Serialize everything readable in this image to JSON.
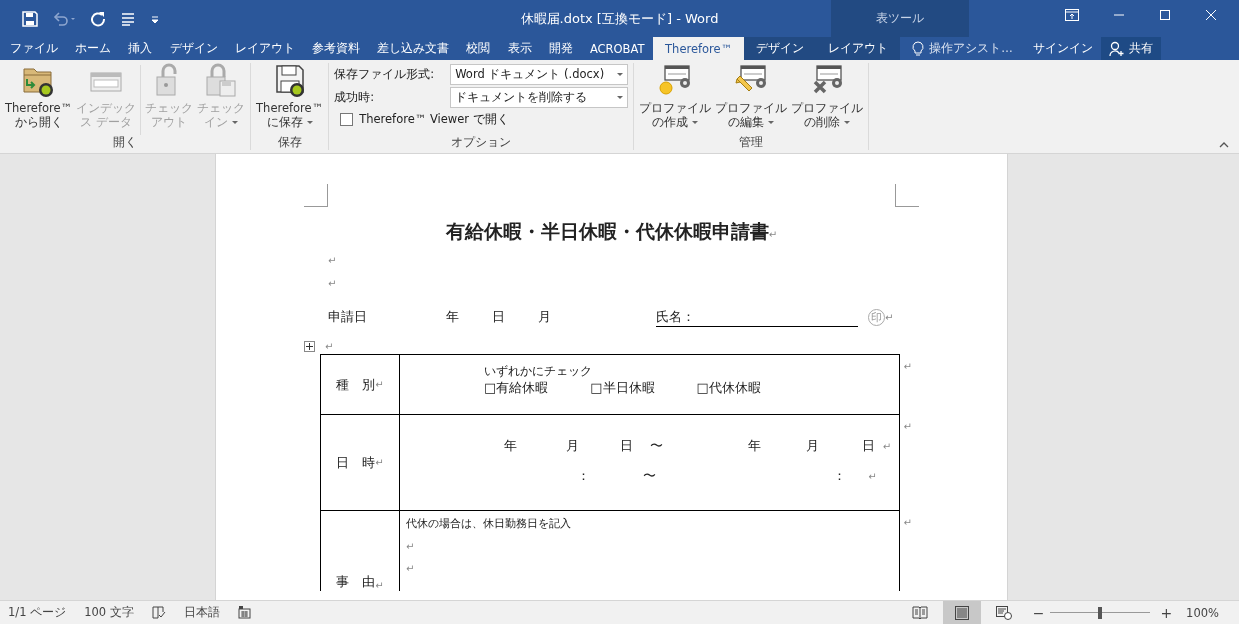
{
  "window": {
    "title": "休暇届.dotx [互換モード] - Word"
  },
  "contextual": {
    "label": "表ツール"
  },
  "tabs": [
    {
      "label": "ファイル",
      "selected": false,
      "contextual": false
    },
    {
      "label": "ホーム",
      "selected": false,
      "contextual": false
    },
    {
      "label": "挿入",
      "selected": false,
      "contextual": false
    },
    {
      "label": "デザイン",
      "selected": false,
      "contextual": false
    },
    {
      "label": "レイアウト",
      "selected": false,
      "contextual": false
    },
    {
      "label": "参考資料",
      "selected": false,
      "contextual": false
    },
    {
      "label": "差し込み文書",
      "selected": false,
      "contextual": false
    },
    {
      "label": "校閲",
      "selected": false,
      "contextual": false
    },
    {
      "label": "表示",
      "selected": false,
      "contextual": false
    },
    {
      "label": "開発",
      "selected": false,
      "contextual": false
    },
    {
      "label": "ACROBAT",
      "selected": false,
      "contextual": false
    },
    {
      "label": "Therefore™",
      "selected": true,
      "contextual": false
    },
    {
      "label": "デザイン",
      "selected": false,
      "contextual": true
    },
    {
      "label": "レイアウト",
      "selected": false,
      "contextual": true
    }
  ],
  "tell_me": {
    "placeholder": "操作アシスト…"
  },
  "sign_in": "サインイン",
  "share": "共有",
  "ribbon": {
    "groups": [
      {
        "label": "開く",
        "items": [
          {
            "kind": "open",
            "lines": [
              "Therefore™",
              "から開く"
            ],
            "disabled": false,
            "dropdown": false
          },
          {
            "kind": "index",
            "lines": [
              "インデック",
              "ス データ"
            ],
            "disabled": true,
            "dropdown": false
          },
          {
            "kind": "checkout",
            "lines": [
              "チェック",
              "アウト"
            ],
            "disabled": true,
            "dropdown": false
          },
          {
            "kind": "checkin",
            "lines": [
              "チェック",
              "イン"
            ],
            "disabled": true,
            "dropdown": true
          }
        ]
      },
      {
        "label": "保存",
        "items": [
          {
            "kind": "save",
            "lines": [
              "Therefore™",
              "に保存"
            ],
            "disabled": false,
            "dropdown": true
          }
        ]
      },
      {
        "label": "オプション",
        "options": {
          "fields": [
            {
              "label": "保存ファイル形式:",
              "value": "Word ドキュメント (.docx)"
            },
            {
              "label": "成功時:",
              "value": "ドキュメントを削除する"
            }
          ],
          "checkbox": {
            "label": "Therefore™ Viewer で開く",
            "checked": false
          }
        }
      },
      {
        "label": "管理",
        "items": [
          {
            "kind": "create",
            "lines": [
              "プロファイル",
              "の作成"
            ],
            "disabled": false,
            "dropdown": true
          },
          {
            "kind": "edit",
            "lines": [
              "プロファイル",
              "の編集"
            ],
            "disabled": false,
            "dropdown": true
          },
          {
            "kind": "delete",
            "lines": [
              "プロファイル",
              "の削除"
            ],
            "disabled": false,
            "dropdown": true
          }
        ]
      }
    ]
  },
  "document": {
    "title": {
      "text": "有給休暇・半日休暇・代休休暇申請書",
      "mark": "↵"
    },
    "blank_paragraphs": [
      {
        "mark": "↵"
      },
      {
        "mark": "↵"
      }
    ],
    "applicant": {
      "date_label": "申請日",
      "date_parts": [
        "年",
        "日",
        "月"
      ],
      "name_label": "氏名：",
      "seal": "印",
      "mark": "↵"
    },
    "table_mark": "↵",
    "table": {
      "rows": [
        {
          "kind": "type",
          "header": "種　別",
          "header_mark": "↵",
          "note": "いずれかにチェック",
          "options": [
            "□有給休暇",
            "□半日休暇",
            "□代休休暇"
          ],
          "end_mark": "↵"
        },
        {
          "kind": "datetime",
          "header": "日　時",
          "header_mark": "↵",
          "line1": [
            "年",
            "月",
            "日",
            "〜",
            "年",
            "月",
            "日"
          ],
          "line1_mark": "↵",
          "line2": [
            "：",
            "〜",
            "："
          ],
          "line2_mark": "↵",
          "end_mark": "↵"
        },
        {
          "kind": "reason",
          "header": "事　由",
          "header_mark": "↵",
          "note": "代休の場合は、休日勤務日を記入",
          "blank_marks": [
            "↵",
            "↵"
          ],
          "end_mark": "↵"
        }
      ]
    }
  },
  "status_bar": {
    "page": "1/1 ページ",
    "words": "100 文字",
    "language": "日本語",
    "views": [
      {
        "kind": "read",
        "selected": false
      },
      {
        "kind": "print",
        "selected": true
      },
      {
        "kind": "web",
        "selected": false
      }
    ],
    "zoom": {
      "level": 0.5,
      "minus": "−",
      "plus": "+",
      "reading": "100%"
    }
  }
}
